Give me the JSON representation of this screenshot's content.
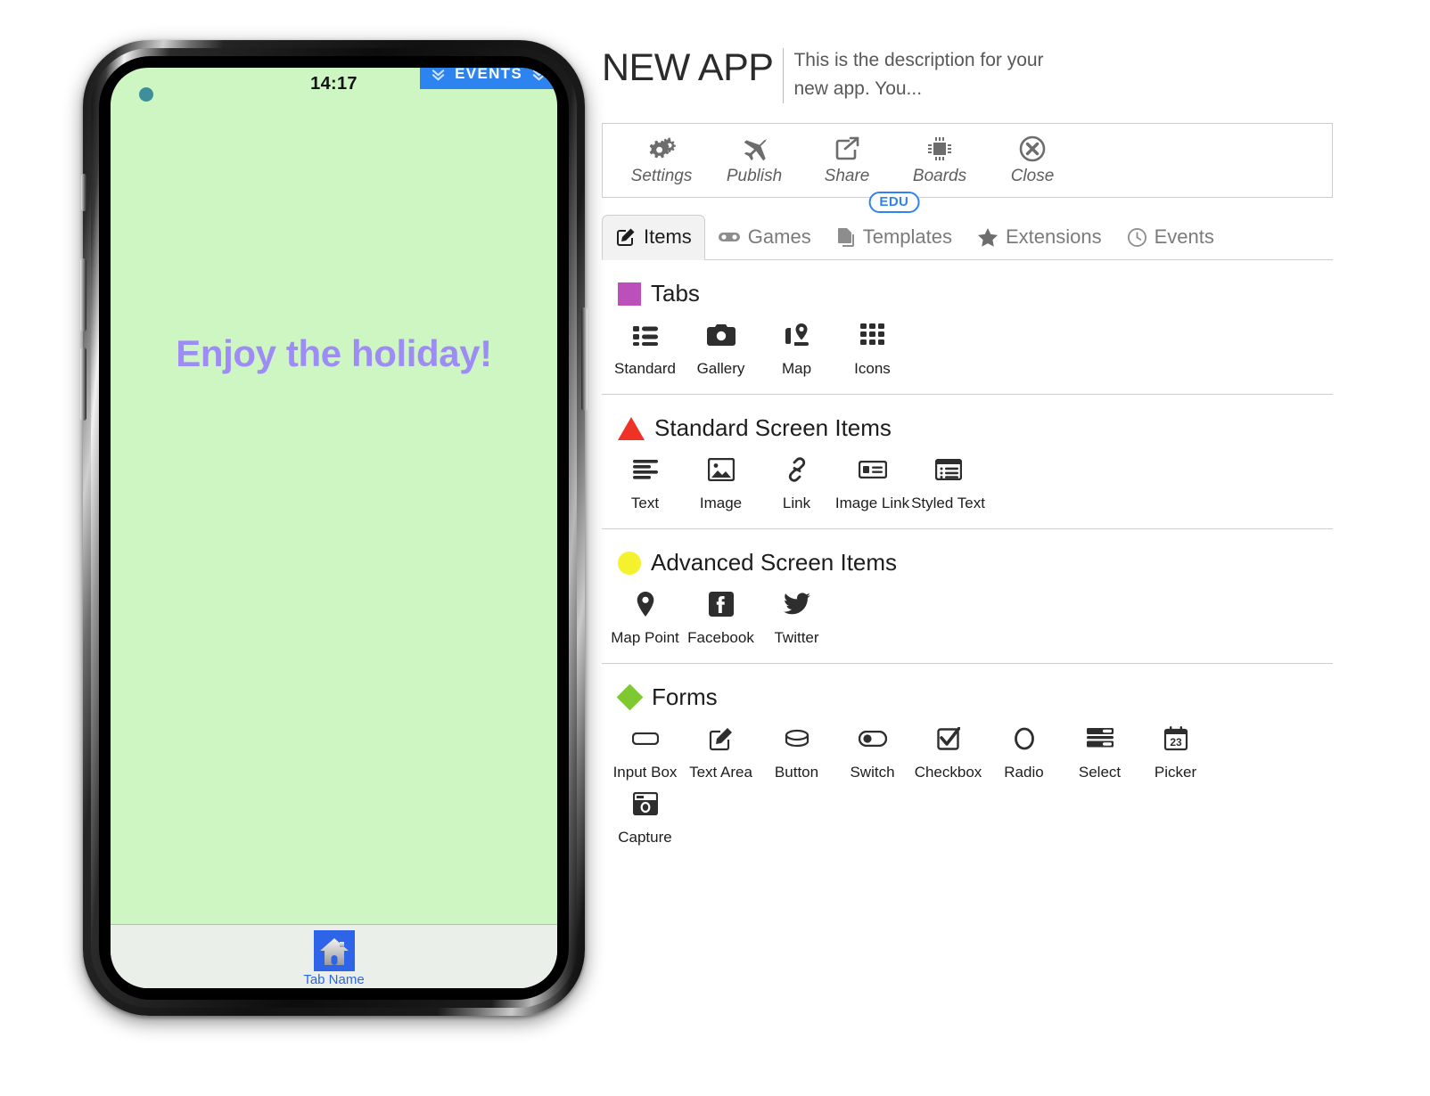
{
  "phone": {
    "status": {
      "time": "14:17",
      "camera_dot": "camera-dot",
      "events_label": "EVENTS"
    },
    "screen": {
      "text": "Enjoy the holiday!",
      "bg_color": "#cdf6c3",
      "text_color": "#9d8cf5"
    },
    "tabbar": {
      "tab_label": "Tab Name",
      "icon": "home-icon",
      "accent": "#2d64e8"
    }
  },
  "header": {
    "title": "NEW APP",
    "description": "This is the description for your new app. You..."
  },
  "toolbar": {
    "items": [
      {
        "label": "Settings",
        "icon": "gears-icon"
      },
      {
        "label": "Publish",
        "icon": "airplane-icon"
      },
      {
        "label": "Share",
        "icon": "share-icon"
      },
      {
        "label": "Boards",
        "icon": "chip-icon"
      },
      {
        "label": "Close",
        "icon": "close-circle-icon"
      }
    ]
  },
  "tabs": {
    "items": [
      {
        "label": "Items",
        "icon": "pen-square-icon",
        "active": true,
        "badge": ""
      },
      {
        "label": "Games",
        "icon": "gamepad-icon",
        "active": false,
        "badge": ""
      },
      {
        "label": "Templates",
        "icon": "copy-icon",
        "active": false,
        "badge": "EDU"
      },
      {
        "label": "Extensions",
        "icon": "star-icon",
        "active": false,
        "badge": ""
      },
      {
        "label": "Events",
        "icon": "clock-icon",
        "active": false,
        "badge": ""
      }
    ]
  },
  "sections": [
    {
      "title": "Tabs",
      "marker": "square",
      "marker_color": "#bb50bb",
      "items": [
        {
          "label": "Standard",
          "icon": "list-icon"
        },
        {
          "label": "Gallery",
          "icon": "camera-icon"
        },
        {
          "label": "Map",
          "icon": "map-pin-route-icon"
        },
        {
          "label": "Icons",
          "icon": "grid-icon"
        }
      ]
    },
    {
      "title": "Standard Screen Items",
      "marker": "triangle",
      "marker_color": "#ef3126",
      "items": [
        {
          "label": "Text",
          "icon": "text-lines-icon"
        },
        {
          "label": "Image",
          "icon": "image-icon"
        },
        {
          "label": "Link",
          "icon": "link-icon"
        },
        {
          "label": "Image Link",
          "icon": "image-link-icon"
        },
        {
          "label": "Styled Text",
          "icon": "styled-text-icon"
        }
      ]
    },
    {
      "title": "Advanced Screen Items",
      "marker": "circle",
      "marker_color": "#f3f22d",
      "items": [
        {
          "label": "Map Point",
          "icon": "map-pin-icon"
        },
        {
          "label": "Facebook",
          "icon": "facebook-icon"
        },
        {
          "label": "Twitter",
          "icon": "twitter-icon"
        }
      ]
    },
    {
      "title": "Forms",
      "marker": "diamond",
      "marker_color": "#7ec832",
      "items": [
        {
          "label": "Input Box",
          "icon": "input-box-icon"
        },
        {
          "label": "Text Area",
          "icon": "text-area-icon"
        },
        {
          "label": "Button",
          "icon": "button-icon"
        },
        {
          "label": "Switch",
          "icon": "switch-icon"
        },
        {
          "label": "Checkbox",
          "icon": "checkbox-icon"
        },
        {
          "label": "Radio",
          "icon": "radio-icon"
        },
        {
          "label": "Select",
          "icon": "select-icon"
        },
        {
          "label": "Picker",
          "icon": "calendar-23-icon"
        },
        {
          "label": "Capture",
          "icon": "capture-icon"
        }
      ]
    }
  ]
}
